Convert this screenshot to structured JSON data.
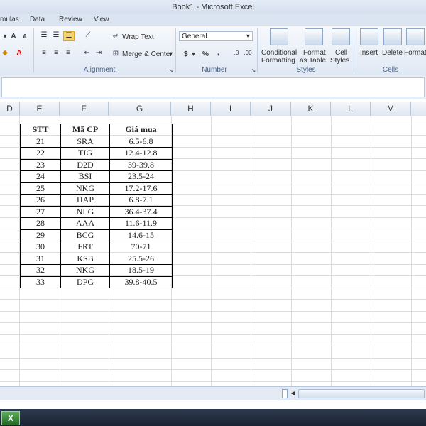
{
  "window": {
    "title": "Book1 - Microsoft Excel"
  },
  "tabs": [
    "mulas",
    "Data",
    "Review",
    "View"
  ],
  "ribbon": {
    "wrap_text": "Wrap Text",
    "merge_center": "Merge & Center",
    "number_format": "General",
    "currency": "$",
    "percent": "%",
    "comma": ",",
    "conditional_formatting": [
      "Conditional",
      "Formatting"
    ],
    "format_as_table": [
      "Format",
      "as Table"
    ],
    "cell_styles": [
      "Cell",
      "Styles"
    ],
    "insert": "Insert",
    "delete": "Delete",
    "format": "Format",
    "groups": {
      "alignment": "Alignment",
      "number": "Number",
      "styles": "Styles",
      "cells": "Cells"
    }
  },
  "columns": [
    "D",
    "E",
    "F",
    "G",
    "H",
    "I",
    "J",
    "K",
    "L",
    "M"
  ],
  "table": {
    "headers": [
      "STT",
      "Mã CP",
      "Giá mua"
    ],
    "rows": [
      [
        "21",
        "SRA",
        "6.5-6.8"
      ],
      [
        "22",
        "TIG",
        "12.4-12.8"
      ],
      [
        "23",
        "D2D",
        "39-39.8"
      ],
      [
        "24",
        "BSI",
        "23.5-24"
      ],
      [
        "25",
        "NKG",
        "17.2-17.6"
      ],
      [
        "26",
        "HAP",
        "6.8-7.1"
      ],
      [
        "27",
        "NLG",
        "36.4-37.4"
      ],
      [
        "28",
        "AAA",
        "11.6-11.9"
      ],
      [
        "29",
        "BCG",
        "14.6-15"
      ],
      [
        "30",
        "FRT",
        "70-71"
      ],
      [
        "31",
        "KSB",
        "25.5-26"
      ],
      [
        "32",
        "NKG",
        "18.5-19"
      ],
      [
        "33",
        "DPG",
        "39.8-40.5"
      ]
    ]
  },
  "taskbar": {
    "excel_icon": "X"
  }
}
